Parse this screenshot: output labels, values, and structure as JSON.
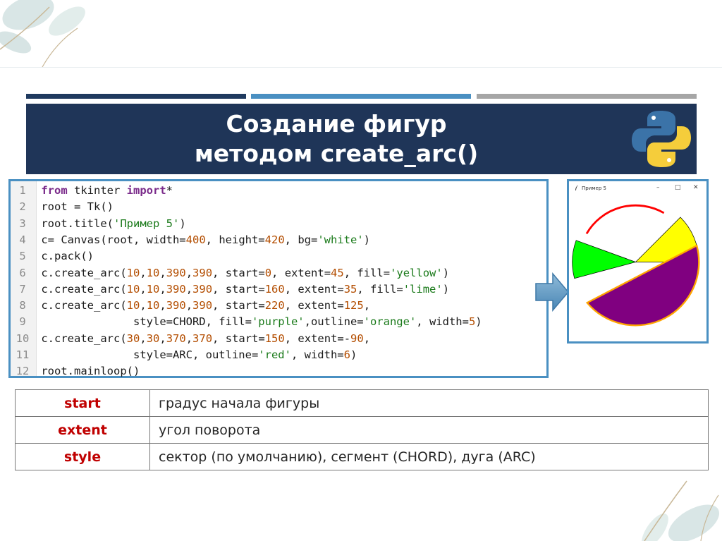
{
  "slide": {
    "title_line1": "Создание фигур",
    "title_line2": "методом create_arc()"
  },
  "code": {
    "lines": [
      {
        "num": "1",
        "tokens": [
          [
            "kw",
            "from"
          ],
          [
            "code",
            " tkinter "
          ],
          [
            "kw",
            "import"
          ],
          [
            "code",
            "*"
          ]
        ]
      },
      {
        "num": "2",
        "tokens": [
          [
            "code",
            "root = Tk()"
          ]
        ]
      },
      {
        "num": "3",
        "tokens": [
          [
            "code",
            "root.title("
          ],
          [
            "str",
            "'Пример 5'"
          ],
          [
            "code",
            ")"
          ]
        ]
      },
      {
        "num": "4",
        "tokens": [
          [
            "code",
            "c= Canvas(root, width="
          ],
          [
            "num",
            "400"
          ],
          [
            "code",
            ", height="
          ],
          [
            "num",
            "420"
          ],
          [
            "code",
            ", bg="
          ],
          [
            "str",
            "'white'"
          ],
          [
            "code",
            ")"
          ]
        ]
      },
      {
        "num": "5",
        "tokens": [
          [
            "code",
            "c.pack()"
          ]
        ]
      },
      {
        "num": "6",
        "tokens": [
          [
            "code",
            "c.create_arc("
          ],
          [
            "num",
            "10"
          ],
          [
            "code",
            ","
          ],
          [
            "num",
            "10"
          ],
          [
            "code",
            ","
          ],
          [
            "num",
            "390"
          ],
          [
            "code",
            ","
          ],
          [
            "num",
            "390"
          ],
          [
            "code",
            ", start="
          ],
          [
            "num",
            "0"
          ],
          [
            "code",
            ", extent="
          ],
          [
            "num",
            "45"
          ],
          [
            "code",
            ", fill="
          ],
          [
            "str",
            "'yellow'"
          ],
          [
            "code",
            ")"
          ]
        ]
      },
      {
        "num": "7",
        "tokens": [
          [
            "code",
            "c.create_arc("
          ],
          [
            "num",
            "10"
          ],
          [
            "code",
            ","
          ],
          [
            "num",
            "10"
          ],
          [
            "code",
            ","
          ],
          [
            "num",
            "390"
          ],
          [
            "code",
            ","
          ],
          [
            "num",
            "390"
          ],
          [
            "code",
            ", start="
          ],
          [
            "num",
            "160"
          ],
          [
            "code",
            ", extent="
          ],
          [
            "num",
            "35"
          ],
          [
            "code",
            ", fill="
          ],
          [
            "str",
            "'lime'"
          ],
          [
            "code",
            ")"
          ]
        ]
      },
      {
        "num": "8",
        "tokens": [
          [
            "code",
            "c.create_arc("
          ],
          [
            "num",
            "10"
          ],
          [
            "code",
            ","
          ],
          [
            "num",
            "10"
          ],
          [
            "code",
            ","
          ],
          [
            "num",
            "390"
          ],
          [
            "code",
            ","
          ],
          [
            "num",
            "390"
          ],
          [
            "code",
            ", start="
          ],
          [
            "num",
            "220"
          ],
          [
            "code",
            ", extent="
          ],
          [
            "num",
            "125"
          ],
          [
            "code",
            ","
          ]
        ]
      },
      {
        "num": "9",
        "tokens": [
          [
            "code",
            "              style=CHORD, fill="
          ],
          [
            "str",
            "'purple'"
          ],
          [
            "code",
            ",outline="
          ],
          [
            "str",
            "'orange'"
          ],
          [
            "code",
            ", width="
          ],
          [
            "num",
            "5"
          ],
          [
            "code",
            ")"
          ]
        ]
      },
      {
        "num": "10",
        "tokens": [
          [
            "code",
            "c.create_arc("
          ],
          [
            "num",
            "30"
          ],
          [
            "code",
            ","
          ],
          [
            "num",
            "30"
          ],
          [
            "code",
            ","
          ],
          [
            "num",
            "370"
          ],
          [
            "code",
            ","
          ],
          [
            "num",
            "370"
          ],
          [
            "code",
            ", start="
          ],
          [
            "num",
            "150"
          ],
          [
            "code",
            ", extent=-"
          ],
          [
            "num",
            "90"
          ],
          [
            "code",
            ","
          ]
        ]
      },
      {
        "num": "11",
        "tokens": [
          [
            "code",
            "              style=ARC, outline="
          ],
          [
            "str",
            "'red'"
          ],
          [
            "code",
            ", width="
          ],
          [
            "num",
            "6"
          ],
          [
            "code",
            ")"
          ]
        ]
      },
      {
        "num": "12",
        "tokens": [
          [
            "code",
            "root.mainloop()"
          ]
        ]
      }
    ]
  },
  "tk_window": {
    "title": "Пример 5",
    "minimize": "–",
    "maximize": "□",
    "close": "✕"
  },
  "params": {
    "rows": [
      {
        "key": "start",
        "desc": "градус начала фигуры"
      },
      {
        "key": "extent",
        "desc": "угол поворота"
      },
      {
        "key": "style",
        "desc": "сектор (по умолчанию), сегмент (CHORD), дуга (ARC)"
      }
    ]
  },
  "colors": {
    "banner": "#1f3558",
    "accent_blue": "#4a90c2",
    "param_key": "#c00000"
  },
  "icons": [
    "python-logo-icon",
    "arrow-right-icon",
    "tk-feather-icon",
    "leaf-decoration-icon"
  ]
}
